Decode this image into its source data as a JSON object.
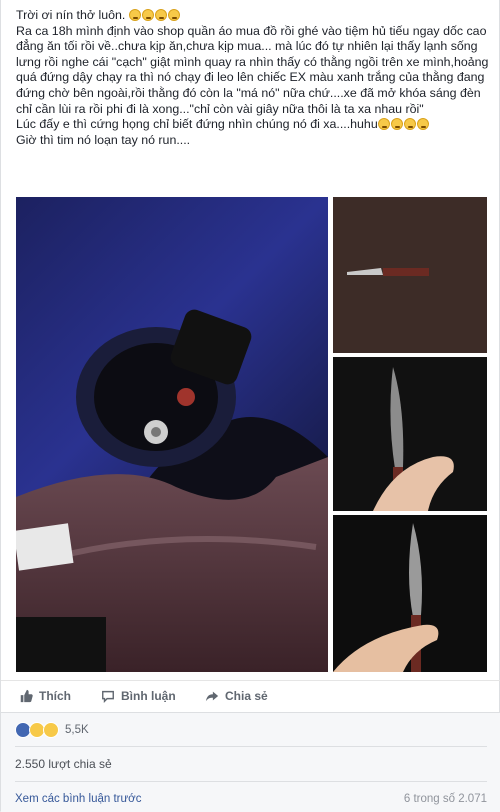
{
  "post": {
    "lines": [
      "Trời ơi nín thở luôn.",
      "Ra ca 18h mình định vào shop quần áo mua đồ rồi ghé vào tiệm hủ tiếu ngay dốc cao đẳng ăn tối rồi về..chưa kịp ăn,chưa kịp mua... mà lúc đó tự nhiên lại thấy lạnh sống lưng rồi nghe cái \"cạch\" giật mình quay ra nhìn thấy có thằng ngồi trên xe mình,hoảng quá đứng dậy chạy ra thì nó chạy đi leo lên chiếc EX màu xanh trắng của thằng đang đứng chờ bên ngoài,rồi thằng đó còn la \"má nó\" nữa chứ....xe đã mở khóa sáng đèn chỉ cần lùi ra rồi phi đi là xong...\"chỉ còn vài giây nữa thôi là ta xa nhau rồi\"",
      "Lúc đấy e thì cứng họng chỉ biết đứng nhìn chúng nó đi xa....huhu",
      "Giờ thì tim nó loạn tay nó run...."
    ]
  },
  "actions": {
    "like": "Thích",
    "comment": "Bình luận",
    "share": "Chia sẻ"
  },
  "reactions": {
    "count": "5,5K"
  },
  "shares": {
    "label": "2.550 lượt chia sẻ"
  },
  "comments": {
    "more": "Xem các bình luận trước",
    "pager": "6 trong số 2.071"
  },
  "colors": {
    "like_blue": "#4267b2",
    "link_blue": "#365899",
    "muted": "#90949c"
  }
}
